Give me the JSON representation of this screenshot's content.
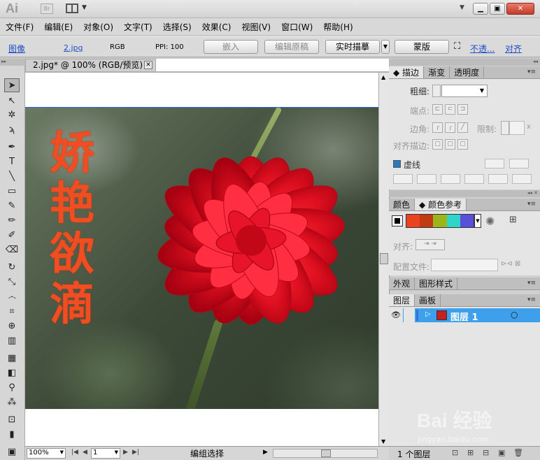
{
  "titlebar": {
    "app_logo": "Ai",
    "bridge_label": "Br"
  },
  "menu": [
    "文件(F)",
    "编辑(E)",
    "对象(O)",
    "文字(T)",
    "选择(S)",
    "效果(C)",
    "视图(V)",
    "窗口(W)",
    "帮助(H)"
  ],
  "control": {
    "image_link": "图像",
    "file_name": "2.jpg",
    "color_mode": "RGB",
    "ppi": "PPI: 100",
    "embed": "嵌入",
    "edit_original": "编辑原稿",
    "live_trace": "实时描摹",
    "mask": "蒙版",
    "opacity_link": "不透...",
    "align_link": "对齐"
  },
  "document": {
    "tab_title": "2.jpg* @ 100% (RGB/预览)",
    "art_text": [
      "娇",
      "艳",
      "欲",
      "滴"
    ],
    "zoom": "100%",
    "page": "1",
    "status": "编组选择"
  },
  "stroke_panel": {
    "tabs": [
      "描边",
      "渐变",
      "透明度"
    ],
    "weight_label": "粗细:",
    "cap_label": "端点:",
    "corner_label": "边角:",
    "limit_label": "限制:",
    "limit_suffix": "x",
    "align_label": "对齐描边:",
    "dashed_label": "虚线"
  },
  "color_panel": {
    "tabs": [
      "颜色",
      "颜色参考"
    ],
    "swatches": [
      "#e8431e",
      "#c23a12",
      "#9bb51a",
      "#2fd6c8",
      "#5a4fd8"
    ],
    "align_label": "对齐:",
    "profile_label": "配置文件:"
  },
  "appearance_panel": {
    "tabs": [
      "外观",
      "图形样式"
    ]
  },
  "layers_panel": {
    "tabs": [
      "图层",
      "画板"
    ],
    "layer_name": "图层 1",
    "layer_count": "1 个图层"
  },
  "watermark": {
    "brand": "Bai 经验",
    "url": "jingyan.baidu.com"
  }
}
